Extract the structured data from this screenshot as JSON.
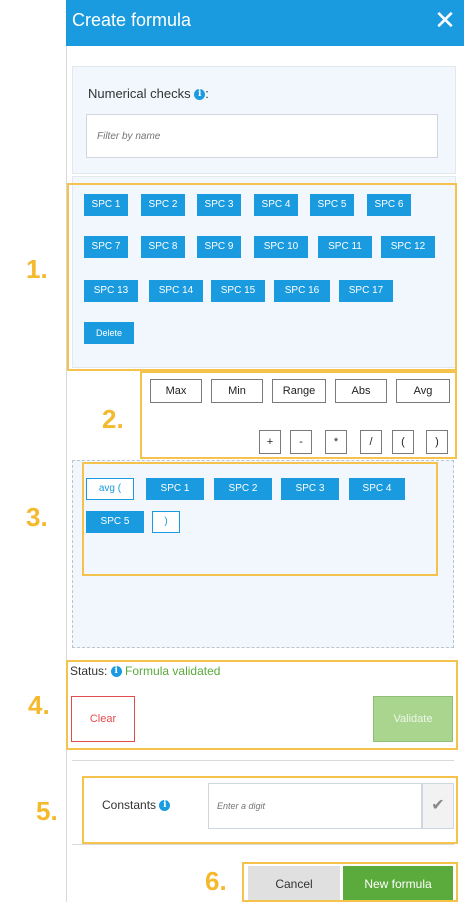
{
  "dialog": {
    "title": "Create formula",
    "close_symbol": "✕"
  },
  "numerical_checks": {
    "label": "Numerical checks",
    "info_symbol": "i",
    "colon": ":",
    "placeholder": "Filter by name",
    "spc_chips": [
      "SPC 1",
      "SPC 2",
      "SPC 3",
      "SPC 4",
      "SPC 5",
      "SPC 6",
      "SPC 7",
      "SPC 8",
      "SPC 9",
      "SPC 10",
      "SPC 11",
      "SPC 12",
      "SPC 13",
      "SPC 14",
      "SPC 15",
      "SPC 16",
      "SPC 17"
    ],
    "delete_label": "Delete"
  },
  "functions": [
    "Max",
    "Min",
    "Range",
    "Abs",
    "Avg"
  ],
  "operators": [
    "+",
    "-",
    "*",
    "/",
    "(",
    ")"
  ],
  "formula_tokens": [
    "avg (",
    "SPC 1",
    "SPC 2",
    "SPC 3",
    "SPC 4",
    "SPC 5",
    ")"
  ],
  "status": {
    "label": "Status:",
    "info_symbol": "i",
    "text": "Formula validated"
  },
  "buttons": {
    "clear": "Clear",
    "validate": "Validate",
    "cancel": "Cancel",
    "new_formula": "New formula"
  },
  "constants": {
    "label": "Constants",
    "info_symbol": "i",
    "placeholder": "Enter a digit",
    "check_symbol": "✔"
  },
  "annotations": [
    "1.",
    "2.",
    "3.",
    "4.",
    "5.",
    "6."
  ],
  "colors": {
    "accent": "#1a9be0",
    "highlight": "#f5c34b",
    "success": "#5aaa3c",
    "danger": "#e34c4c"
  }
}
